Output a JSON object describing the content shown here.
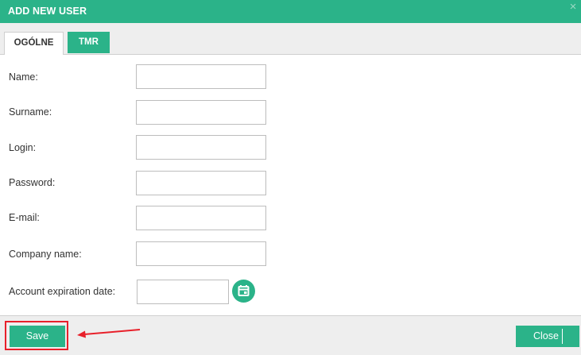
{
  "dialog": {
    "title": "ADD NEW USER",
    "close_glyph": "×"
  },
  "tabs": [
    {
      "label": "OGÓLNE",
      "active": true
    },
    {
      "label": "TMR",
      "active": false
    }
  ],
  "form": {
    "fields": [
      {
        "label": "Name:",
        "value": ""
      },
      {
        "label": "Surname:",
        "value": ""
      },
      {
        "label": "Login:",
        "value": ""
      },
      {
        "label": "Password:",
        "value": ""
      },
      {
        "label": "E-mail:",
        "value": ""
      },
      {
        "label": "Company name:",
        "value": ""
      },
      {
        "label": "Account expiration date:",
        "value": ""
      }
    ],
    "calendar_icon": "calendar-icon"
  },
  "footer": {
    "save_label": "Save",
    "close_label": "Close"
  },
  "annotations": {
    "highlight_color": "#e8202a"
  },
  "colors": {
    "accent": "#2bb389",
    "panel": "#eeeeee",
    "highlight": "#e8202a"
  }
}
